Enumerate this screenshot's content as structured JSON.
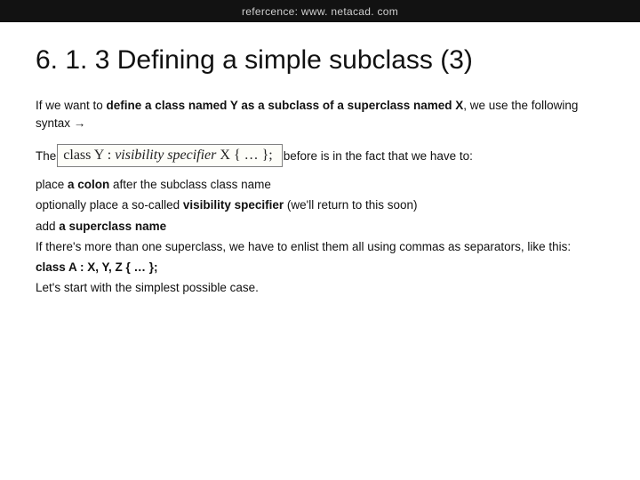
{
  "header": {
    "reference": "refercence: www. netacad. com"
  },
  "title": "6. 1. 3 Defining a simple subclass (3)",
  "intro": {
    "p1_a": "If we want to ",
    "p1_b": "define a class named Y as a subclass of a superclass named X",
    "p1_c": ", we use the following syntax →"
  },
  "codebox": {
    "before": "The ",
    "t1": "class Y : ",
    "vis": "visibility specifier",
    "t2": " X { … };",
    "after": " before is in the fact that we have to:"
  },
  "list": {
    "i1_a": "place ",
    "i1_b": "a colon",
    "i1_c": " after the subclass class name",
    "i2_a": "optionally place a so-called ",
    "i2_b": "visibility specifier",
    "i2_c": " (we'll return to this soon)",
    "i3_a": "add ",
    "i3_b": "a superclass name",
    "i4": "If there's more than one superclass, we have to enlist them all using commas as separators, like this:",
    "i5": "class A : X, Y, Z { … };",
    "i6": "Let's start with the simplest possible case."
  }
}
